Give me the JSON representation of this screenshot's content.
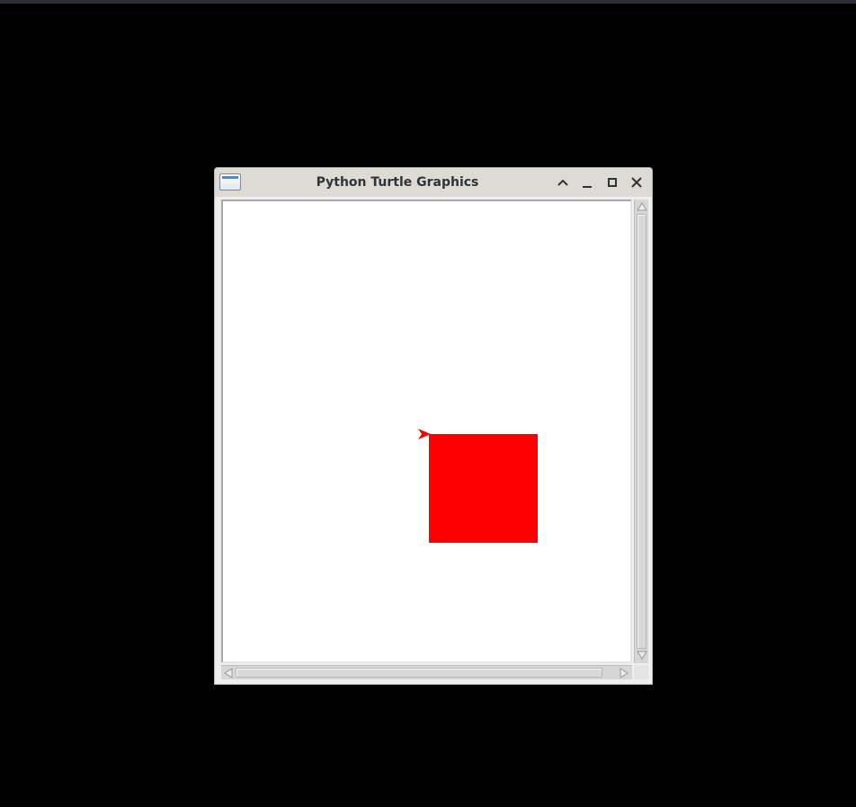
{
  "window": {
    "title": "Python Turtle Graphics",
    "icons": {
      "app": "app-window-icon",
      "shade": "chevron-up-icon",
      "minimize": "minimize-icon",
      "maximize": "maximize-icon",
      "close": "close-icon"
    }
  },
  "canvas": {
    "background": "#ffffff",
    "shapes": [
      {
        "type": "filled-square",
        "color": "#ff0000"
      }
    ],
    "turtle": {
      "shape": "arrow",
      "color": "#ff0000",
      "heading": "east"
    }
  },
  "colors": {
    "desktop": "#000000",
    "titlebar": "#dedbd7",
    "accent": "#ff0000"
  }
}
